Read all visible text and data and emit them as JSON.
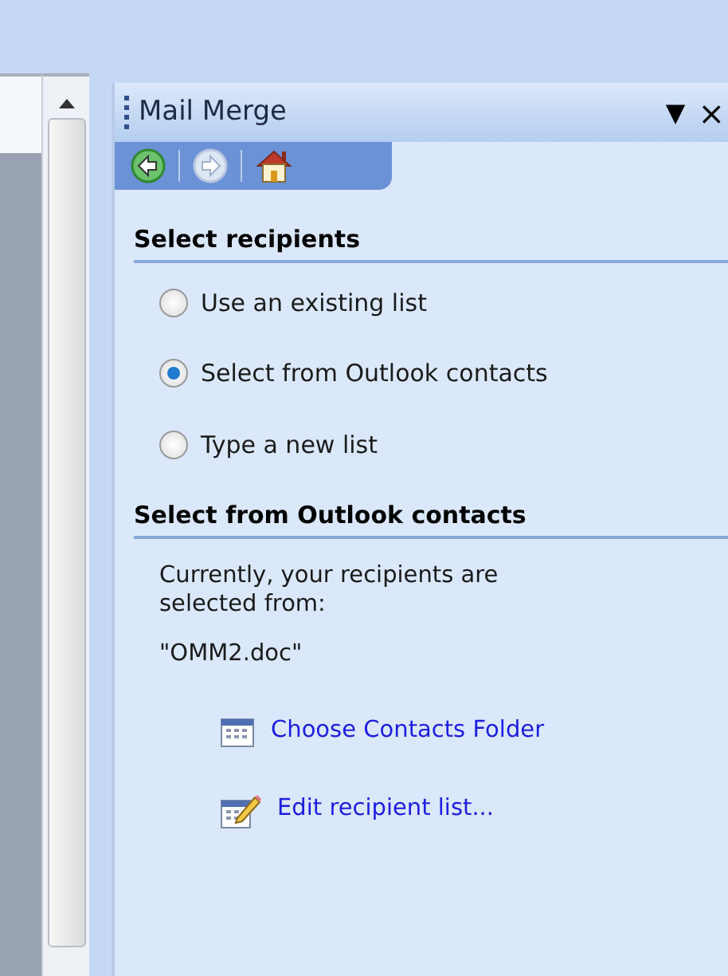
{
  "task_pane": {
    "title": "Mail Merge",
    "menu_glyph": "▼",
    "close_glyph": "×"
  },
  "nav_buttons": [
    {
      "kind": "back",
      "disabled": false
    },
    {
      "kind": "forward",
      "disabled": true
    },
    {
      "kind": "home",
      "disabled": false
    }
  ],
  "sections": [
    {
      "heading": "Select recipients",
      "options": [
        {
          "label": "Use an existing list",
          "selected": false
        },
        {
          "label": "Select from Outlook contacts",
          "selected": true
        },
        {
          "label": "Type a new list",
          "selected": false
        }
      ]
    },
    {
      "heading": "Select from Outlook contacts",
      "paragraphs": [
        "Currently, your recipients are selected from:",
        "\"OMM2.doc\""
      ],
      "links": [
        {
          "kind": "folder",
          "label": "Choose Contacts Folder"
        },
        {
          "kind": "edit",
          "label": "Edit recipient list..."
        }
      ]
    }
  ]
}
